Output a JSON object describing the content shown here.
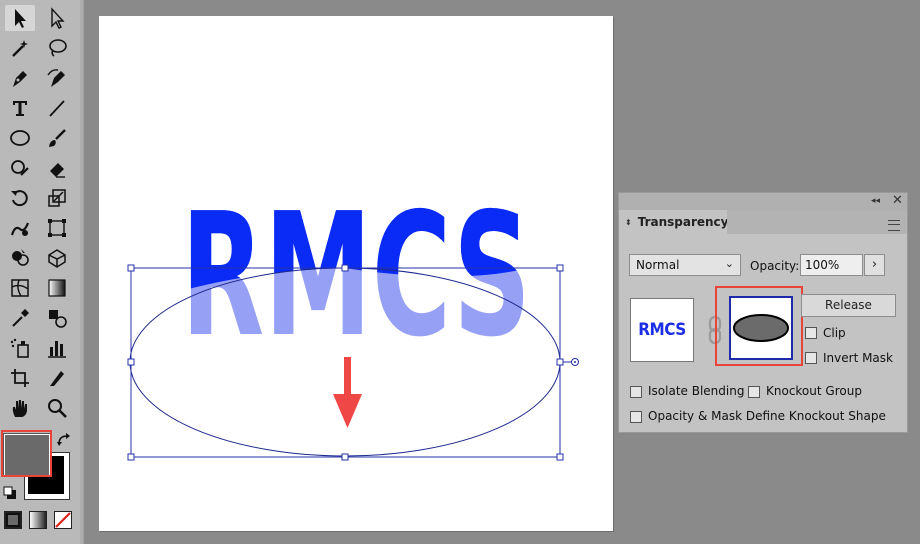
{
  "toolbar": {
    "tools": [
      {
        "name": "selection-tool",
        "icon": "arrow-icon",
        "selected": true
      },
      {
        "name": "direct-selection-tool",
        "icon": "hollow-arrow-icon"
      },
      {
        "name": "magic-wand-tool",
        "icon": "magic-wand-icon"
      },
      {
        "name": "lasso-tool",
        "icon": "lasso-icon"
      },
      {
        "name": "pen-tool",
        "icon": "pen-icon"
      },
      {
        "name": "curvature-tool",
        "icon": "curvature-pen-icon"
      },
      {
        "name": "type-tool",
        "icon": "type-icon"
      },
      {
        "name": "line-segment-tool",
        "icon": "line-icon"
      },
      {
        "name": "ellipse-tool",
        "icon": "ellipse-icon"
      },
      {
        "name": "paintbrush-tool",
        "icon": "brush-icon"
      },
      {
        "name": "shaper-tool",
        "icon": "shaper-icon"
      },
      {
        "name": "eraser-tool",
        "icon": "eraser-icon"
      },
      {
        "name": "rotate-tool",
        "icon": "rotate-icon"
      },
      {
        "name": "scale-tool",
        "icon": "scale-icon"
      },
      {
        "name": "warp-tool",
        "icon": "warp-icon"
      },
      {
        "name": "free-transform-tool",
        "icon": "free-transform-icon"
      },
      {
        "name": "shape-builder-tool",
        "icon": "shape-builder-icon"
      },
      {
        "name": "perspective-grid-tool",
        "icon": "perspective-icon"
      },
      {
        "name": "mesh-tool",
        "icon": "mesh-icon"
      },
      {
        "name": "gradient-tool",
        "icon": "gradient-icon"
      },
      {
        "name": "eyedropper-tool",
        "icon": "eyedropper-icon"
      },
      {
        "name": "blend-tool",
        "icon": "blend-icon"
      },
      {
        "name": "symbol-sprayer-tool",
        "icon": "symbol-sprayer-icon"
      },
      {
        "name": "column-graph-tool",
        "icon": "column-graph-icon"
      },
      {
        "name": "artboard-tool",
        "icon": "artboard-icon"
      },
      {
        "name": "slice-tool",
        "icon": "slice-icon"
      },
      {
        "name": "hand-tool",
        "icon": "hand-icon"
      },
      {
        "name": "zoom-tool",
        "icon": "zoom-icon"
      }
    ],
    "fill_color": "#6a6a6a",
    "stroke_color": "#000000"
  },
  "artboard": {
    "text": "RMCS",
    "text_color": "#0a2bf5",
    "masked_color": "#96a1f6",
    "arrow_color": "#ef4646"
  },
  "panel": {
    "tab_label": "Transparency",
    "blend_mode": "Normal",
    "opacity_label": "Opacity:",
    "opacity_value": "100%",
    "art_thumbnail_text": "RMCS",
    "release_label": "Release",
    "clip_label": "Clip",
    "invert_mask_label": "Invert Mask",
    "isolate_blending_label": "Isolate Blending",
    "knockout_group_label": "Knockout Group",
    "opacity_mask_knockout_label": "Opacity & Mask Define Knockout Shape",
    "highlight_color": "#e8443a"
  }
}
